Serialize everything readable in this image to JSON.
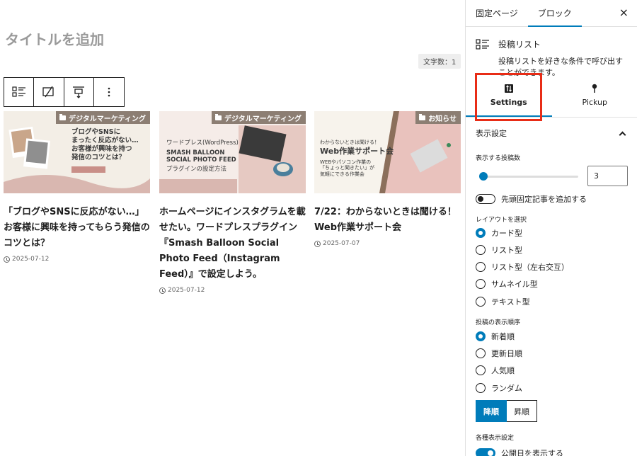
{
  "editor": {
    "title_placeholder": "タイトルを追加",
    "word_count": "文字数：1",
    "toolbar": [
      "post-list-block-icon",
      "transform-icon",
      "align-icon",
      "more-options-icon"
    ]
  },
  "posts": [
    {
      "category": "デジタルマーケティング",
      "thumb_lines": [
        "ブログやSNSに",
        "まったく反応がない…",
        "お客様が興味を持つ",
        "発信のコツとは？"
      ],
      "title": "「ブログやSNSに反応がない…」お客様に興味を持ってもらう発信のコツとは？",
      "date": "2025-07-12"
    },
    {
      "category": "デジタルマーケティング",
      "thumb_lines": [
        "ワードプレス(WordPress)",
        "SMASH BALLOON",
        "SOCIAL PHOTO FEED",
        "プラグインの設定方法"
      ],
      "title": "ホームページにインスタグラムを載せたい。ワードプレスプラグイン『Smash Balloon Social Photo Feed（Instagram Feed）』で設定しよう。",
      "date": "2025-07-12"
    },
    {
      "category": "お知らせ",
      "thumb_lines": [
        "わからないときは聞ける！",
        "Web作業サポート会",
        "WEBやパソコン作業の",
        "「ちょっと聞きたい」が",
        "気軽にできる作業会"
      ],
      "title": "7/22：わからないときは聞ける！Web作業サポート会",
      "date": "2025-07-07"
    }
  ],
  "sidebar": {
    "tabs": [
      "固定ページ",
      "ブロック"
    ],
    "active_tab": "ブロック",
    "close": "×",
    "block": {
      "name": "投稿リスト",
      "description": "投稿リストを好きな条件で呼び出すことができます。"
    },
    "inner_tabs": [
      {
        "label": "Settings",
        "icon": "sliders-icon",
        "active": true
      },
      {
        "label": "Pickup",
        "icon": "pin-icon",
        "active": false
      }
    ],
    "panel_title": "表示設定",
    "count_label": "表示する投稿数",
    "count_value": "3",
    "count_fraction": 0.0,
    "sticky_label": "先頭固定記事を追加する",
    "sticky_on": false,
    "layout_label": "レイアウトを選択",
    "layouts": [
      "カード型",
      "リスト型",
      "リスト型（左右交互）",
      "サムネイル型",
      "テキスト型"
    ],
    "layout_selected": 0,
    "order_label": "投稿の表示順序",
    "orders": [
      "新着順",
      "更新日順",
      "人気順",
      "ランダム"
    ],
    "order_selected": 0,
    "direction": [
      "降順",
      "昇順"
    ],
    "direction_selected": 0,
    "display_label": "各種表示設定",
    "pubdate_label": "公開日を表示する",
    "pubdate_on": true,
    "highlight_color": "#e82c16",
    "accent_color": "#007cba"
  }
}
